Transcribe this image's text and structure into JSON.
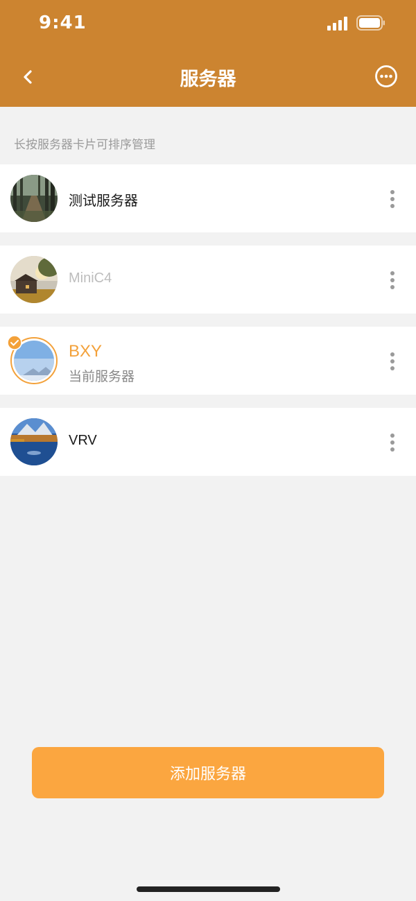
{
  "status_bar": {
    "time": "9:41"
  },
  "header": {
    "title": "服务器",
    "back_icon": "chevron-left-icon",
    "more_icon": "more-horizontal-icon"
  },
  "hint": "长按服务器卡片可排序管理",
  "servers": [
    {
      "name": "测试服务器",
      "subtitle": "",
      "state": "normal",
      "avatar": "forest-path-image"
    },
    {
      "name": "MiniC4",
      "subtitle": "",
      "state": "disabled",
      "avatar": "cabin-sunset-image"
    },
    {
      "name": "BXY",
      "subtitle": "当前服务器",
      "state": "current",
      "avatar": "sky-mountain-image"
    },
    {
      "name": "VRV",
      "subtitle": "",
      "state": "normal",
      "avatar": "autumn-lake-image"
    }
  ],
  "add_button": "添加服务器",
  "colors": {
    "header": "#cc8430",
    "accent": "#f3a13a",
    "button": "#fba640",
    "background": "#f2f2f2"
  }
}
